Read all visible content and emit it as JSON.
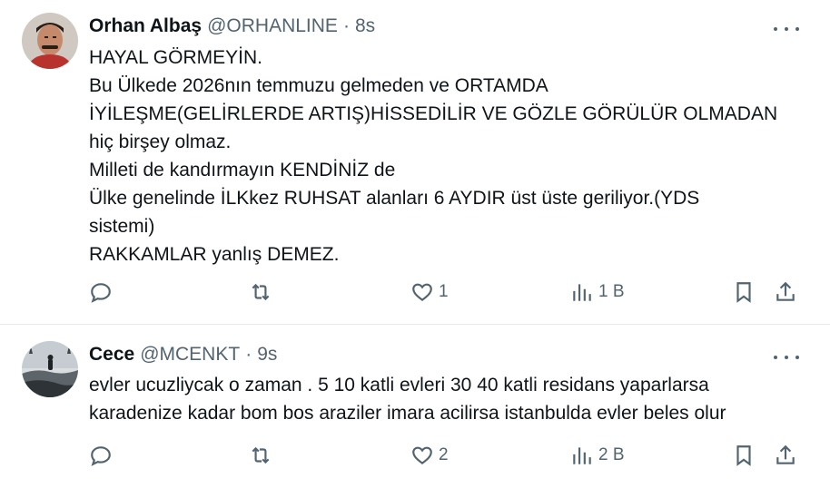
{
  "tweets": [
    {
      "author": "Orhan Albaş",
      "handle": "@ORHANLINE",
      "separator": "·",
      "time": "8s",
      "lines": [
        "HAYAL GÖRMEYİN.",
        "Bu Ülkede 2026nın temmuzu gelmeden ve ORTAMDA",
        "İYİLEŞME(GELİRLERDE ARTIŞ)HİSSEDİLİR VE GÖZLE GÖRÜLÜR OLMADAN",
        "hiç birşey olmaz.",
        "Milleti de kandırmayın KENDİNİZ de",
        "Ülke genelinde İLKkez RUHSAT alanları 6 AYDIR üst üste geriliyor.(YDS",
        "sistemi)",
        "RAKKAMLAR yanlış DEMEZ."
      ],
      "likes": "1",
      "views": "1 B",
      "icons": [
        "reply-icon",
        "retweet-icon",
        "heart-icon",
        "views-icon",
        "bookmark-icon",
        "share-icon",
        "more-icon"
      ]
    },
    {
      "author": "Cece",
      "handle": "@MCENKT",
      "separator": "·",
      "time": "9s",
      "lines": [
        "evler ucuzliycak o zaman . 5 10 katli evleri 30 40 katli residans yaparlarsa",
        "karadenize kadar bom bos araziler imara acilirsa istanbulda evler beles olur"
      ],
      "likes": "2",
      "views": "2 B",
      "icons": [
        "reply-icon",
        "retweet-icon",
        "heart-icon",
        "views-icon",
        "bookmark-icon",
        "share-icon",
        "more-icon"
      ]
    }
  ],
  "colors": {
    "text": "#0f1419",
    "secondary": "#536471",
    "divider": "#e6e9eb"
  }
}
